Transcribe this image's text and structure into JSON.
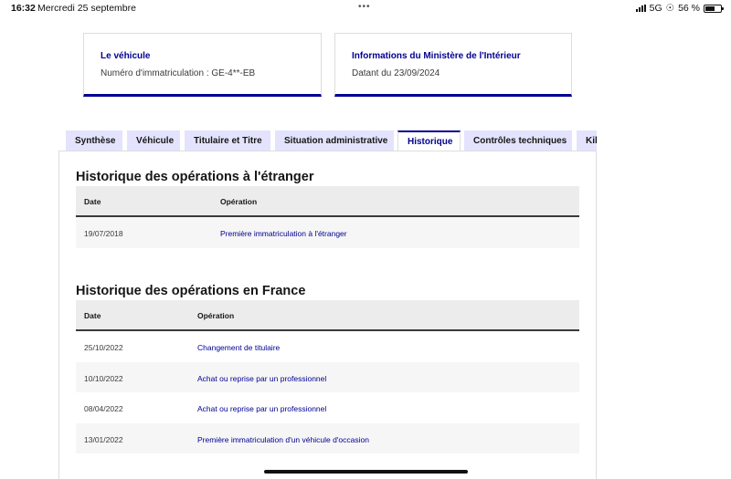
{
  "status_bar": {
    "time": "16:32",
    "date": "Mercredi 25 septembre",
    "network": "5G",
    "battery": "56 %",
    "dots": "•••"
  },
  "cards": {
    "vehicle": {
      "title": "Le véhicule",
      "subtitle": "Numéro d'immatriculation : GE-4**-EB"
    },
    "ministry": {
      "title": "Informations du Ministère de l'Intérieur",
      "subtitle": "Datant du 23/09/2024"
    }
  },
  "tabs": [
    {
      "label": "Synthèse"
    },
    {
      "label": "Véhicule"
    },
    {
      "label": "Titulaire et Titre"
    },
    {
      "label": "Situation administrative"
    },
    {
      "label": "Historique",
      "active": true
    },
    {
      "label": "Contrôles techniques"
    },
    {
      "label": "Kil"
    }
  ],
  "foreign": {
    "title": "Historique des opérations à l'étranger",
    "headers": {
      "date": "Date",
      "operation": "Opération"
    },
    "rows": [
      {
        "date": "19/07/2018",
        "operation": "Première immatriculation à l'étranger"
      }
    ]
  },
  "france": {
    "title": "Historique des opérations en France",
    "headers": {
      "date": "Date",
      "operation": "Opération"
    },
    "rows": [
      {
        "date": "25/10/2022",
        "operation": "Changement de titulaire"
      },
      {
        "date": "10/10/2022",
        "operation": "Achat ou reprise par un professionnel"
      },
      {
        "date": "08/04/2022",
        "operation": "Achat ou reprise par un professionnel"
      },
      {
        "date": "13/01/2022",
        "operation": "Première immatriculation d'un véhicule d'occasion"
      }
    ]
  },
  "colors": {
    "accent": "#000091",
    "tab_background": "#e3e3fd",
    "header_background": "#ececec",
    "row_alt": "#f6f6f6"
  }
}
